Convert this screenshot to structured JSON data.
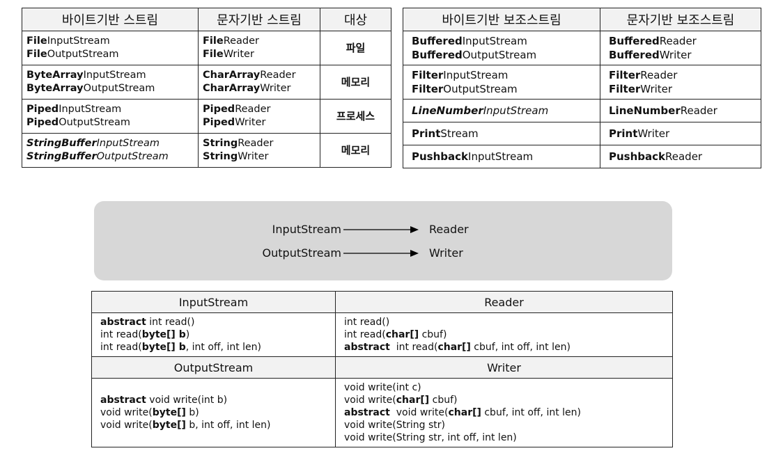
{
  "stream_table": {
    "headers": [
      "바이트기반 스트림",
      "문자기반 스트림",
      "대상"
    ],
    "rows": [
      {
        "byte": [
          {
            "bold": "File",
            "rest": "InputStream"
          },
          {
            "bold": "File",
            "rest": "OutputStream"
          }
        ],
        "char": [
          {
            "bold": "File",
            "rest": "Reader"
          },
          {
            "bold": "File",
            "rest": "Writer"
          }
        ],
        "target": "파일"
      },
      {
        "byte": [
          {
            "bold": "ByteArray",
            "rest": "InputStream"
          },
          {
            "bold": "ByteArray",
            "rest": "OutputStream"
          }
        ],
        "char": [
          {
            "bold": "CharArray",
            "rest": "Reader"
          },
          {
            "bold": "CharArray",
            "rest": "Writer"
          }
        ],
        "target": "메모리"
      },
      {
        "byte": [
          {
            "bold": "Piped",
            "rest": "InputStream"
          },
          {
            "bold": "Piped",
            "rest": "OutputStream"
          }
        ],
        "char": [
          {
            "bold": "Piped",
            "rest": "Reader"
          },
          {
            "bold": "Piped",
            "rest": "Writer"
          }
        ],
        "target": "프로세스"
      },
      {
        "byte": [
          {
            "bold": "StringBuffer",
            "rest": "InputStream"
          },
          {
            "bold": "StringBuffer",
            "rest": "OutputStream"
          }
        ],
        "char": [
          {
            "bold": "String",
            "rest": "Reader"
          },
          {
            "bold": "String",
            "rest": "Writer"
          }
        ],
        "target": "메모리"
      }
    ]
  },
  "aux_table": {
    "headers": [
      "바이트기반 보조스트림",
      "문자기반 보조스트림"
    ],
    "rows": [
      {
        "byte": [
          {
            "bold": "Buffered",
            "rest": "InputStream"
          },
          {
            "bold": "Buffered",
            "rest": "OutputStream"
          }
        ],
        "char": [
          {
            "bold": "Buffered",
            "rest": "Reader"
          },
          {
            "bold": "Buffered",
            "rest": "Writer"
          }
        ]
      },
      {
        "byte": [
          {
            "bold": "Filter",
            "rest": "InputStream"
          },
          {
            "bold": "Filter",
            "rest": "OutputStream"
          }
        ],
        "char": [
          {
            "bold": "Filter",
            "rest": "Reader"
          },
          {
            "bold": "Filter",
            "rest": "Writer"
          }
        ]
      },
      {
        "byte": [
          {
            "bold": "LineNumber",
            "rest": "InputStream"
          }
        ],
        "char": [
          {
            "bold": "LineNumber",
            "rest": "Reader"
          }
        ]
      },
      {
        "byte": [
          {
            "bold": "Print",
            "rest": "Stream"
          }
        ],
        "char": [
          {
            "bold": "Print",
            "rest": "Writer"
          }
        ]
      },
      {
        "byte": [
          {
            "bold": "Pushback",
            "rest": "InputStream"
          }
        ],
        "char": [
          {
            "bold": "Pushback",
            "rest": "Reader"
          }
        ]
      }
    ]
  },
  "mapping": {
    "rows": [
      {
        "from": "InputStream",
        "to": "Reader"
      },
      {
        "from": "OutputStream",
        "to": "Writer"
      }
    ]
  },
  "method_table": {
    "input": {
      "left_header": "InputStream",
      "right_header": "Reader",
      "left_lines": [
        {
          "bold": "abstract",
          "rest": " int read()"
        },
        {
          "pre": "int read(",
          "bold": "byte[] b",
          "rest": ")"
        },
        {
          "pre": "int read(",
          "bold": "byte[] b",
          "rest": ", int off, int len)"
        }
      ],
      "right_lines": [
        {
          "pre": "int read()"
        },
        {
          "pre": "int read(",
          "bold": "char[]",
          "rest": " cbuf)"
        },
        {
          "bold": "abstract",
          "rest": "  int read(",
          "bold2": "char[]",
          "rest2": " cbuf, int off, int len)"
        }
      ]
    },
    "output": {
      "left_header": "OutputStream",
      "right_header": "Writer",
      "left_lines": [
        {
          "bold": "abstract",
          "rest": " void write(int b)"
        },
        {
          "pre": "void write(",
          "bold": "byte[]",
          "rest": " b)"
        },
        {
          "pre": "void write(",
          "bold": "byte[]",
          "rest": " b, int off, int len)"
        }
      ],
      "right_lines": [
        {
          "pre": "void write(int c)"
        },
        {
          "pre": "void write(",
          "bold": "char[]",
          "rest": " cbuf)"
        },
        {
          "bold": "abstract",
          "rest": "  void write(",
          "bold2": "char[]",
          "rest2": " cbuf, int off, int len)"
        },
        {
          "pre": "void write(String str)"
        },
        {
          "pre": "void write(String str, int off, int len)"
        }
      ]
    }
  }
}
